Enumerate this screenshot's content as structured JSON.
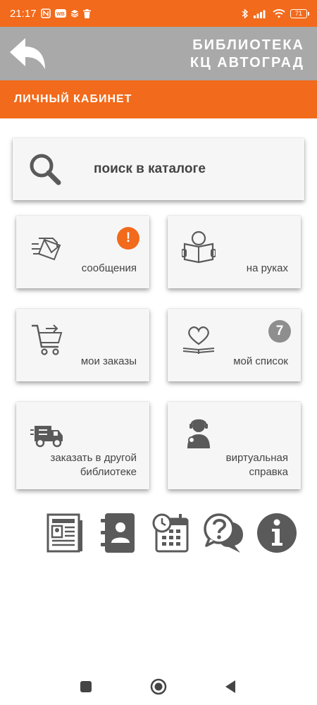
{
  "status_bar": {
    "time": "21:17",
    "battery": "71",
    "left_icons": [
      "nfc-icon",
      "notification-app-icon",
      "layers-icon",
      "trash-icon"
    ],
    "right_icons": [
      "bluetooth-icon",
      "signal-icon",
      "wifi-icon",
      "battery-icon"
    ]
  },
  "header": {
    "title_line1": "БИБЛИОТЕКА",
    "title_line2": "КЦ АВТОГРАД",
    "back_icon": "back-arrow-icon"
  },
  "section": {
    "title": "ЛИЧНЫЙ КАБИНЕТ"
  },
  "search": {
    "label": "поиск в каталоге",
    "icon": "search-icon"
  },
  "tiles": [
    {
      "id": "messages",
      "icon": "envelope-icon",
      "label": "сообщения",
      "badge": "!"
    },
    {
      "id": "on-hand",
      "icon": "reader-icon",
      "label": "на руках"
    },
    {
      "id": "orders",
      "icon": "cart-icon",
      "label": "мои заказы"
    },
    {
      "id": "my-list",
      "icon": "heart-book-icon",
      "label": "мой список",
      "badge": "7"
    },
    {
      "id": "other-library",
      "icon": "truck-icon",
      "label_line1": "заказать в другой",
      "label_line2": "библиотеке"
    },
    {
      "id": "virtual-help",
      "icon": "librarian-icon",
      "label_line1": "виртуальная",
      "label_line2": "справка"
    }
  ],
  "bottom_icons": [
    "newspaper-icon",
    "contacts-icon",
    "calendar-clock-icon",
    "help-chat-icon",
    "info-icon"
  ],
  "colors": {
    "accent": "#f26a1b",
    "header_gray": "#a9a9a9",
    "icon_gray": "#5a5a5a",
    "badge_orange": "#f26a1b",
    "badge_gray": "#8e8e8e",
    "card_bg": "#f6f6f6"
  }
}
